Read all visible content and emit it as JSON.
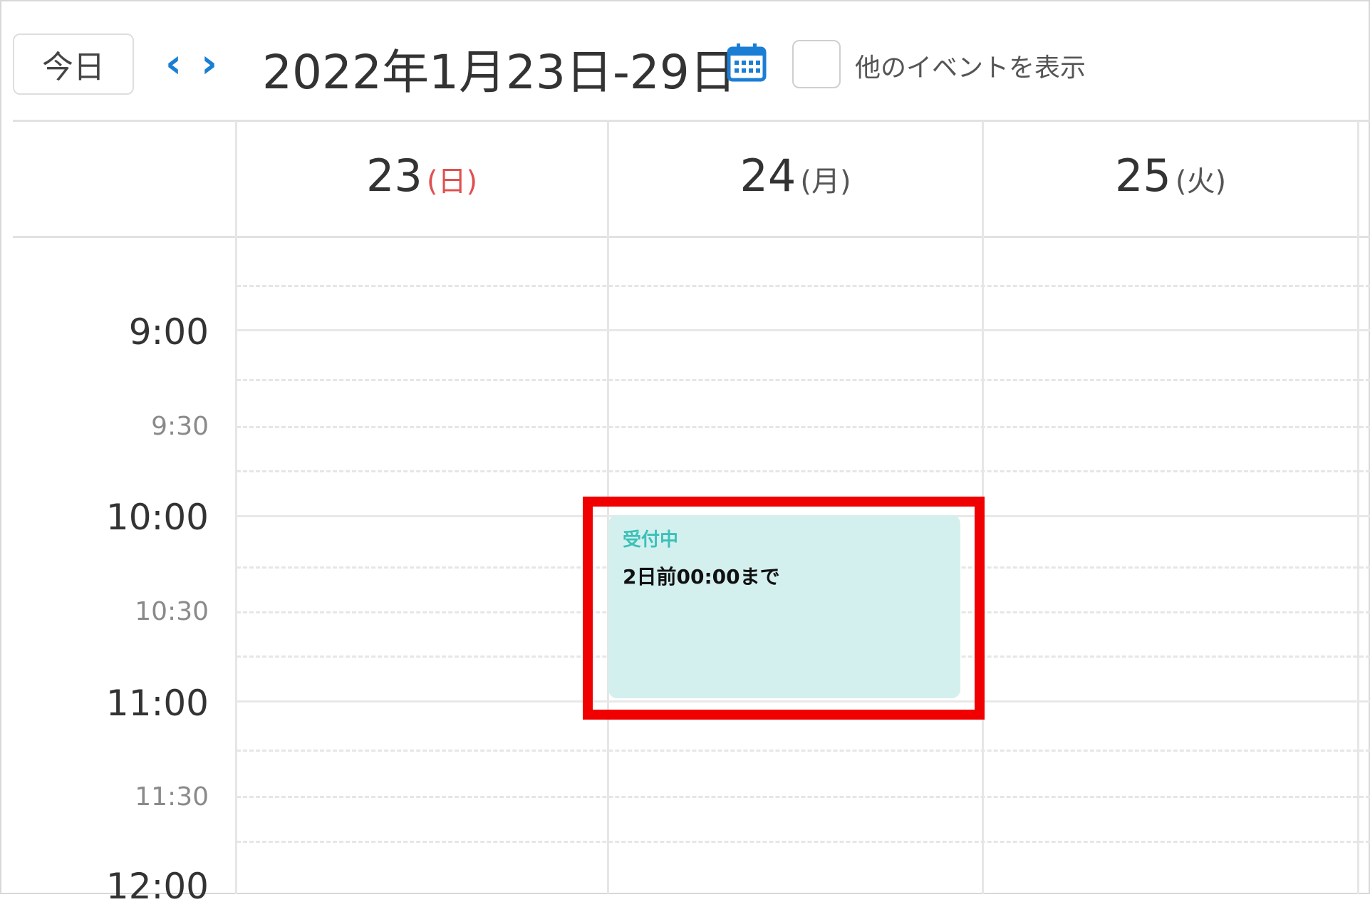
{
  "toolbar": {
    "today_label": "今日",
    "prev_symbol": "‹",
    "next_symbol": "›",
    "date_range": "2022年1月23日-29日",
    "show_others_label": "他のイベントを表示",
    "show_others_checked": false
  },
  "days": [
    {
      "num": "23",
      "weekday": "(日)"
    },
    {
      "num": "24",
      "weekday": "(月)"
    },
    {
      "num": "25",
      "weekday": "(火)"
    }
  ],
  "times": {
    "t900": "9:00",
    "t930": "9:30",
    "t1000": "10:00",
    "t1030": "10:30",
    "t1100": "11:00",
    "t1130": "11:30",
    "t1200": "12:00"
  },
  "event": {
    "status": "受付中",
    "deadline": "2日前00:00まで"
  },
  "colors": {
    "accent": "#1a7fd4",
    "sunday": "#e05050",
    "event_bg": "#d3f0ef",
    "event_status": "#3cc0b8",
    "highlight": "#f00000"
  }
}
